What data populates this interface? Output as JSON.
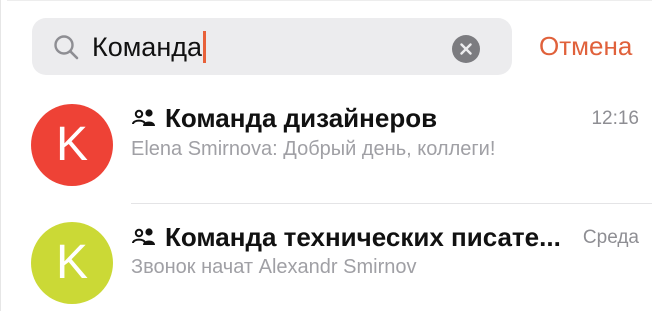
{
  "search": {
    "query": "Команда",
    "cancel_label": "Отмена"
  },
  "chats": [
    {
      "avatar_letter": "K",
      "avatar_color": "#ee4236",
      "title": "Команда дизайнеров",
      "time": "12:16",
      "preview": "Elena Smirnova: Добрый день, коллеги!"
    },
    {
      "avatar_letter": "K",
      "avatar_color": "#cbd936",
      "title": "Команда технических писате...",
      "time": "Среда",
      "preview": "Звонок начат Alexandr Smirnov"
    }
  ],
  "colors": {
    "accent": "#e0613b",
    "caret": "#e8613a"
  }
}
